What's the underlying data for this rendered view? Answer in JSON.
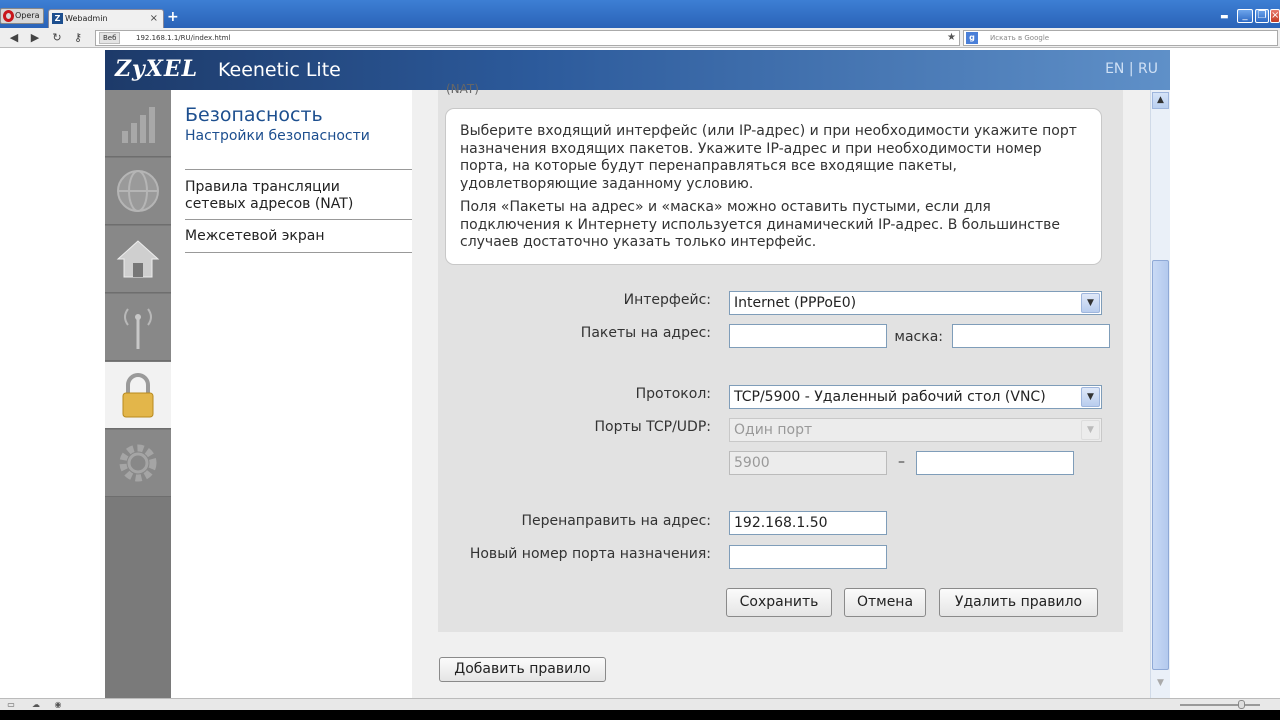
{
  "browser": {
    "menu_label": "Opera",
    "tab_title": "Webadmin",
    "new_tab_label": "+",
    "url_badge": "Веб",
    "url": "192.168.1.1/RU/index.html",
    "search_placeholder": "Искать в Google",
    "search_engine_icon": "google-icon"
  },
  "header": {
    "brand": "ZyXEL",
    "product": "Keenetic Lite",
    "lang_en": "EN",
    "lang_sep": "|",
    "lang_ru": "RU"
  },
  "sidebar_icons": [
    "signal-icon",
    "globe-icon",
    "home-network-icon",
    "wifi-antenna-icon",
    "lock-icon",
    "gear-icon"
  ],
  "nav": {
    "title": "Безопасность",
    "subtitle": "Настройки безопасности",
    "items": [
      {
        "label_line1": "Правила трансляции",
        "label_line2": "сетевых адресов (NAT)"
      },
      {
        "label": "Межсетевой экран"
      }
    ]
  },
  "form": {
    "cut_text": "(NAT)",
    "info_p1": "Выберите входящий интерфейс (или IP-адрес) и при необходимости укажите порт назначения входящих пакетов. Укажите IP-адрес и при необходимости номер порта, на которые будут перенаправляться все входящие пакеты, удовлетворяющие заданному условию.",
    "info_p2": "Поля «Пакеты на адрес» и «маска» можно оставить пустыми, если для подключения к Интернету используется динамический IP-адрес. В большинстве случаев достаточно указать только интерфейс.",
    "interface_label": "Интерфейс:",
    "interface_value": "Internet (PPPoE0)",
    "packets_label": "Пакеты на адрес:",
    "packets_value": "",
    "mask_label": "маска:",
    "mask_value": "",
    "protocol_label": "Протокол:",
    "protocol_value": "TCP/5900 - Удаленный рабочий стол (VNC)",
    "ports_label": "Порты TCP/UDP:",
    "ports_mode_value": "Один порт",
    "port_from": "5900",
    "port_dash": "–",
    "port_to": "",
    "redirect_label": "Перенаправить на адрес:",
    "redirect_value": "192.168.1.50",
    "new_port_label": "Новый номер порта назначения:",
    "new_port_value": "",
    "save_label": "Сохранить",
    "cancel_label": "Отмена",
    "delete_label": "Удалить правило",
    "add_rule_label": "Добавить правило"
  }
}
